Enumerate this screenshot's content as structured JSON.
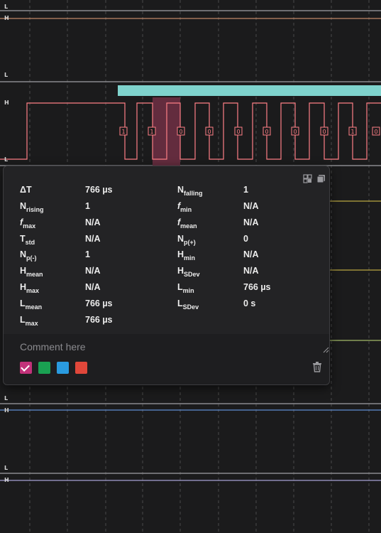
{
  "levels": {
    "high": "H",
    "low": "L"
  },
  "bits": [
    "1",
    "1",
    "0",
    "0",
    "0",
    "0",
    "0",
    "0",
    "1",
    "0"
  ],
  "colors": {
    "background": "#1b1b1c",
    "grid": "#4a4a4a",
    "ch1_line": "#e8a07a",
    "ch2_line": "#ff7f86",
    "ch3_line": "#e0c94a",
    "ch4_line": "#c6e27a",
    "ch5_line": "#6fa8ff",
    "ch6_line": "#c7c1ff",
    "protocol_bar": "#7fd3cd",
    "selection": "#6c2f43"
  },
  "measurements": {
    "delta_t": {
      "label": "ΔT",
      "value": "766 µs"
    },
    "n_falling": {
      "label": "N",
      "sub": "falling",
      "value": "1"
    },
    "n_rising": {
      "label": "N",
      "sub": "rising",
      "value": "1"
    },
    "f_min": {
      "label": "f",
      "sub": "min",
      "value": "N/A"
    },
    "f_max": {
      "label": "f",
      "sub": "max",
      "value": "N/A"
    },
    "f_mean": {
      "label": "f",
      "sub": "mean",
      "value": "N/A"
    },
    "t_std": {
      "label": "T",
      "sub": "std",
      "value": "N/A"
    },
    "n_p_plus": {
      "label": "N",
      "sub": "p(+)",
      "value": "0"
    },
    "n_p_minus": {
      "label": "N",
      "sub": "p(-)",
      "value": "1"
    },
    "h_min": {
      "label": "H",
      "sub": "min",
      "value": "N/A"
    },
    "h_mean": {
      "label": "H",
      "sub": "mean",
      "value": "N/A"
    },
    "h_sdev": {
      "label": "H",
      "sub": "SDev",
      "value": "N/A"
    },
    "h_max": {
      "label": "H",
      "sub": "max",
      "value": "N/A"
    },
    "l_min": {
      "label": "L",
      "sub": "min",
      "value": "766 µs"
    },
    "l_mean": {
      "label": "L",
      "sub": "mean",
      "value": "766 µs"
    },
    "l_sdev": {
      "label": "L",
      "sub": "SDev",
      "value": "0 s"
    },
    "l_max": {
      "label": "L",
      "sub": "max",
      "value": "766 µs"
    }
  },
  "comment": {
    "placeholder": "Comment here"
  },
  "swatches": [
    "#c2327a",
    "#1aa152",
    "#2a9be0",
    "#e0473a"
  ],
  "icons": {
    "pin": "pin-icon",
    "copy": "copy-icon",
    "delete": "trash-icon",
    "resize": "resize-handle-icon"
  }
}
